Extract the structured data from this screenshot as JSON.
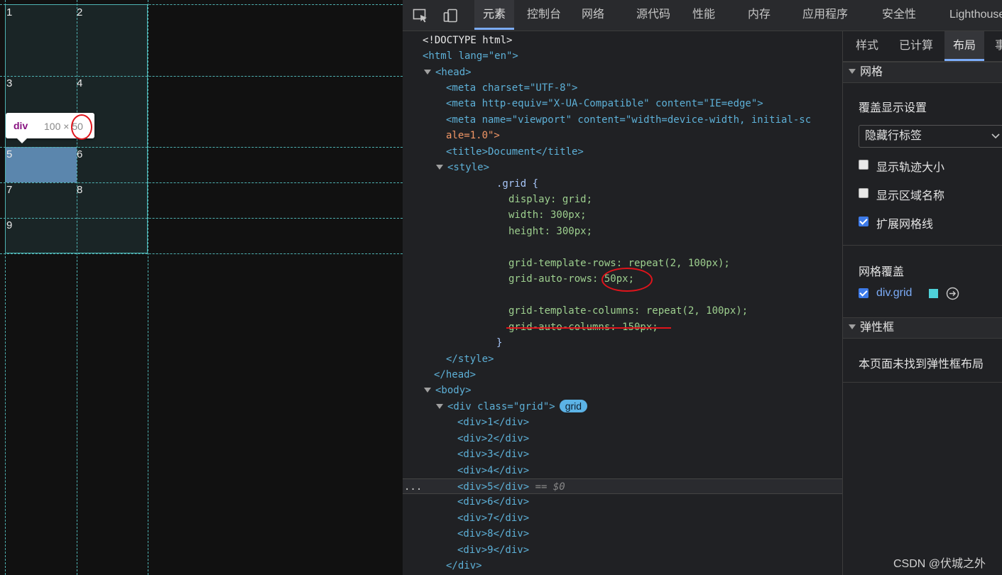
{
  "viewport": {
    "cells": [
      "1",
      "2",
      "3",
      "4",
      "5",
      "6",
      "7",
      "8",
      "9"
    ],
    "tooltip": {
      "tag": "div",
      "dims": "100 × 50"
    }
  },
  "devtools": {
    "tabs": [
      "元素",
      "控制台",
      "网络",
      "源代码",
      "性能",
      "内存",
      "应用程序",
      "安全性",
      "Lighthouse"
    ],
    "active_tab": "元素",
    "code": {
      "doctype": "<!DOCTYPE html>",
      "html_open": "<html lang=\"en\">",
      "head_open": "<head>",
      "meta1": "<meta charset=\"UTF-8\">",
      "meta2": "<meta http-equiv=\"X-UA-Compatible\" content=\"IE=edge\">",
      "meta3a": "<meta name=\"viewport\" content=\"width=device-width, initial-sc",
      "meta3b": "ale=1.0\">",
      "title": "<title>Document</title>",
      "style_open": "<style>",
      "css_sel": ".grid {",
      "css_display": "display: grid;",
      "css_width": "width: 300px;",
      "css_height": "height: 300px;",
      "css_rows": "grid-template-rows: repeat(2, 100px);",
      "css_auto_rows": "grid-auto-rows: 50px;",
      "css_cols": "grid-template-columns: repeat(2, 100px);",
      "css_auto_cols": "grid-auto-columns: 150px;",
      "css_close": "}",
      "style_close": "</style>",
      "head_close": "</head>",
      "body_open": "<body>",
      "div_open": "<div class=\"grid\">",
      "badge": "grid",
      "children": [
        "<div>1</div>",
        "<div>2</div>",
        "<div>3</div>",
        "<div>4</div>",
        "<div>5</div>",
        "<div>6</div>",
        "<div>7</div>",
        "<div>8</div>",
        "<div>9</div>"
      ],
      "selected_suffix": "== $0",
      "ellipsis": "...",
      "div_close": "</div>"
    },
    "sidepanel": {
      "subtabs": [
        "样式",
        "已计算",
        "布局",
        "事"
      ],
      "active_subtab": "布局",
      "grid_section": "网格",
      "overlay_settings": "覆盖显示设置",
      "select_value": "隐藏行标签",
      "checkboxes": [
        {
          "label": "显示轨迹大小",
          "checked": false
        },
        {
          "label": "显示区域名称",
          "checked": false
        },
        {
          "label": "扩展网格线",
          "checked": true
        }
      ],
      "grid_overlay": "网格覆盖",
      "overlay_item": "div.grid",
      "overlay_color": "#4fd1d9",
      "flex_section": "弹性框",
      "flex_empty": "本页面未找到弹性框布局"
    }
  },
  "watermark": "CSDN @伏城之外"
}
